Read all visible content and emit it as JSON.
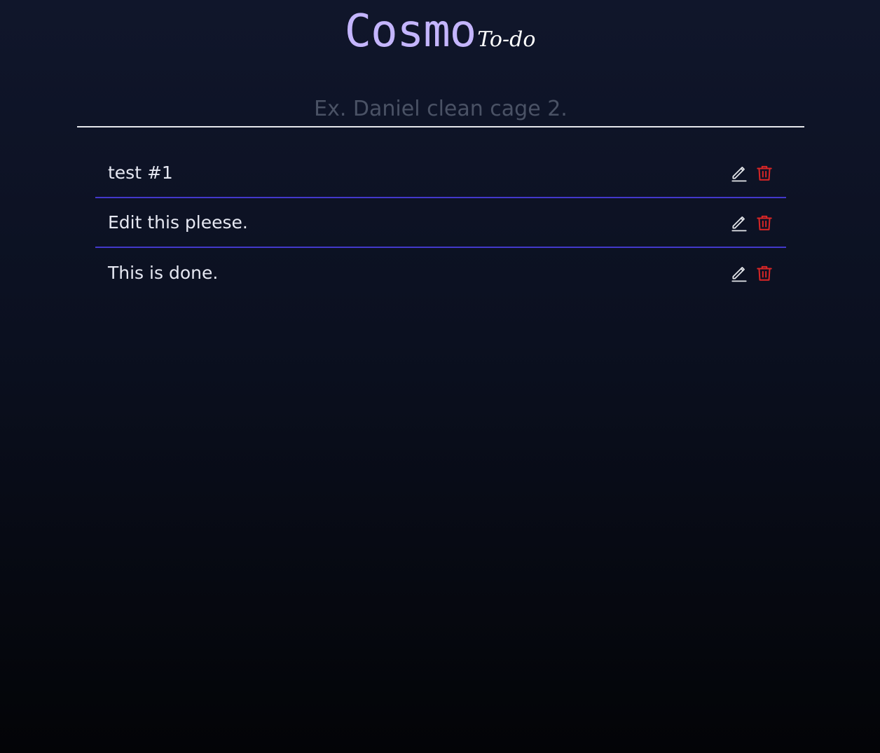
{
  "header": {
    "brand": "Cosmo",
    "subtitle": "To-do"
  },
  "input": {
    "placeholder": "Ex. Daniel clean cage 2.",
    "value": ""
  },
  "todos": [
    {
      "text": "test #1"
    },
    {
      "text": "Edit this pleese."
    },
    {
      "text": "This is done."
    }
  ],
  "icons": {
    "edit": "pencil-icon",
    "delete": "trash-icon"
  },
  "colors": {
    "brand": "#c4b5fd",
    "divider": "#4338ca",
    "delete": "#dc2626",
    "edit": "#e5e7eb"
  }
}
